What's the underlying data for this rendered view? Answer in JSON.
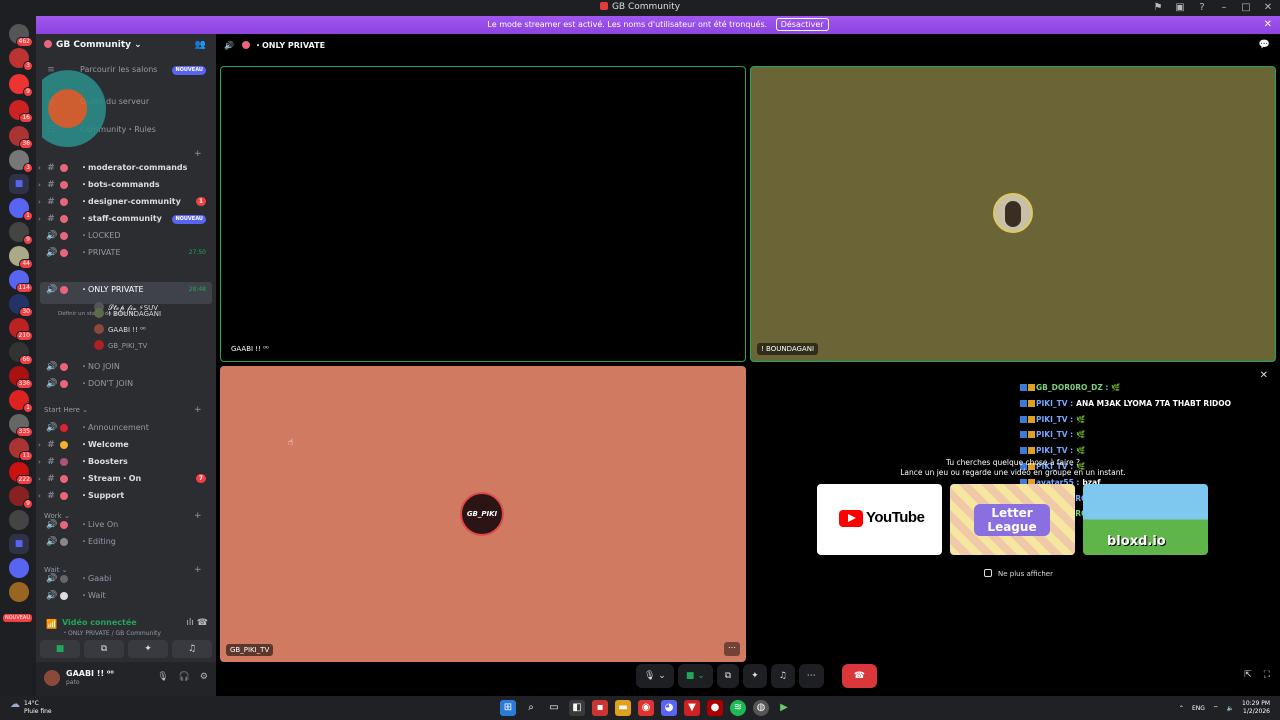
{
  "window": {
    "title": "GB Community"
  },
  "banner": {
    "text": "Le mode streamer est activé. Les noms d'utilisateur ont été tronqués.",
    "button": "Désactiver",
    "close": "✕"
  },
  "server_rail": {
    "badges": [
      "462",
      "3",
      "9",
      "16",
      "36",
      "3",
      "1",
      "9",
      "44",
      "114",
      "30",
      "210",
      "66",
      "336",
      "1",
      "335",
      "11",
      "222",
      "9"
    ],
    "new_pill": "NOUVEAU"
  },
  "sidebar": {
    "guild_name": "GB Community",
    "browse_label": "Parcourir les salons",
    "browse_badge": "NOUVEAU",
    "server_guide": "Guide du serveur",
    "rules_row": "Community・Rules",
    "channels": [
      {
        "name": "・moderator-commands",
        "type": "text",
        "bold": true
      },
      {
        "name": "・bots-commands",
        "type": "text",
        "bold": true
      },
      {
        "name": "・designer-community",
        "type": "text",
        "bold": true,
        "badge": "1"
      },
      {
        "name": "・staff-community",
        "type": "text",
        "bold": true,
        "new": "NOUVEAU"
      },
      {
        "name": "・LOCKED",
        "type": "voice"
      },
      {
        "name": "・PRIVATE",
        "type": "voice",
        "time": "27:50"
      },
      {
        "name": "・ONLY PRIVATE",
        "type": "voice",
        "time": "28:48",
        "sub": "Définir un statut de salon ✎"
      },
      {
        "name": "・NO JOIN",
        "type": "voice"
      },
      {
        "name": "・DON'T JOIN",
        "type": "voice"
      }
    ],
    "private_user": "𝓢𝓽𝓸𝓹 𝓯𝓲𝔁 ⚡SUV",
    "voice_users": [
      "! BOUNDAGANI",
      "GAABI !! ⁰⁰",
      "GB_PIKI_TV"
    ],
    "categories": {
      "start_here": "Start Here",
      "work": "Work",
      "wait": "Wait"
    },
    "start_here_channels": [
      {
        "name": "・Announcement"
      },
      {
        "name": "・Welcome"
      },
      {
        "name": "・Boosters"
      },
      {
        "name": "・Stream・On",
        "badge": "7"
      },
      {
        "name": "・Support"
      }
    ],
    "work_channels": [
      "・Live On",
      "・Editing"
    ],
    "wait_channels": [
      "・Gaabi",
      "・Wait"
    ],
    "voice_status": {
      "title": "Vidéo connectée",
      "location": "・ONLY PRIVATE / GB Community"
    },
    "user": {
      "name": "GAABI !! ⁰⁰",
      "status": "pato"
    }
  },
  "main": {
    "channel_title": "・ONLY PRIVATE",
    "tiles": [
      {
        "label": "GAABI !! ⁰⁰"
      },
      {
        "label": "! BOUNDAGANI"
      },
      {
        "label": "GB_PIKI_TV"
      }
    ],
    "tile3_avatar_text": "GB_PIKI"
  },
  "chat_overlay": [
    {
      "name": "GB_DOR0RO_DZ :",
      "text": "🌿",
      "color": "green"
    },
    {
      "name": "PIKI_TV :",
      "text": "ANA M3AK LYOMA 7TA THABT RIDOO",
      "color": "blue"
    },
    {
      "name": "PIKI_TV :",
      "text": "🌿",
      "color": "blue"
    },
    {
      "name": "PIKI_TV :",
      "text": "🌿",
      "color": "blue"
    },
    {
      "name": "PIKI_TV :",
      "text": "🌿",
      "color": "blue"
    },
    {
      "name": "PIKI_TV :",
      "text": "🌿",
      "color": "blue"
    },
    {
      "name": "avatar55 :",
      "text": "bzaf",
      "color": "blue"
    },
    {
      "name": "GB_DOR0RO :",
      "text": "GOOD",
      "color": "blue"
    },
    {
      "name": "GB_DOR0RO_DZ :",
      "text": "🌿",
      "color": "green"
    }
  ],
  "activity": {
    "title_line1": "Tu cherches quelque chose à faire ?",
    "title_line2": "Lance un jeu ou regarde une vidéo en groupe en un instant.",
    "cards": [
      {
        "name": "YouTube"
      },
      {
        "name": "Letter League"
      },
      {
        "name": "bloxd.io"
      }
    ],
    "no_show": "Ne plus afficher"
  },
  "taskbar": {
    "weather_temp": "14°C",
    "weather_desc": "Pluie fine",
    "lang": "ENG",
    "time": "10:29 PM",
    "date": "1/2/2026"
  }
}
